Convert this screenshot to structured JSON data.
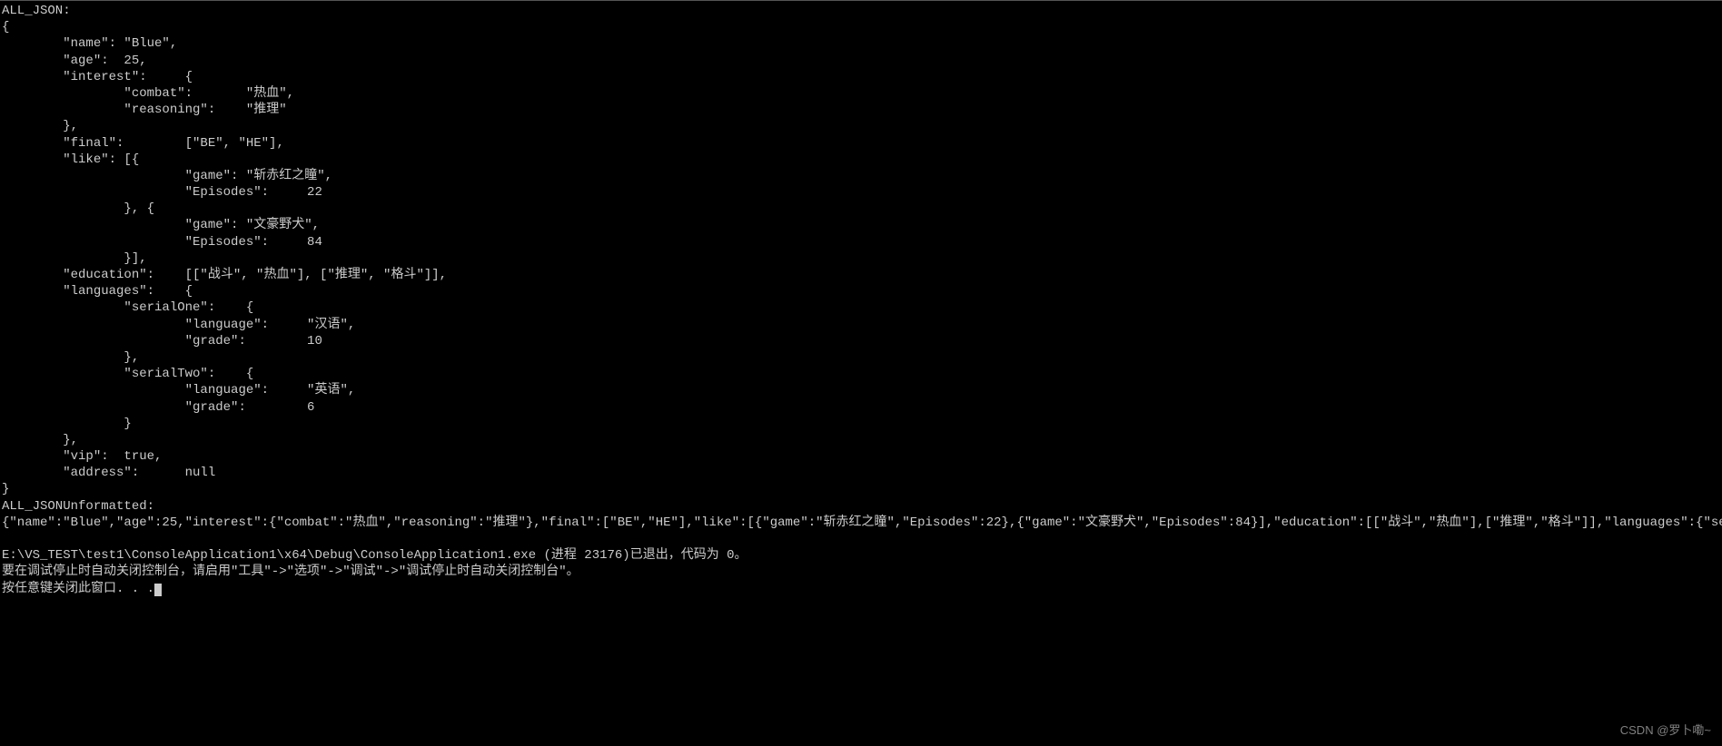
{
  "console": {
    "header1": "ALL_JSON:",
    "json_formatted": "{\n        \"name\": \"Blue\",\n        \"age\":  25,\n        \"interest\":     {\n                \"combat\":       \"热血\",\n                \"reasoning\":    \"推理\"\n        },\n        \"final\":        [\"BE\", \"HE\"],\n        \"like\": [{\n                        \"game\": \"斩赤红之瞳\",\n                        \"Episodes\":     22\n                }, {\n                        \"game\": \"文豪野犬\",\n                        \"Episodes\":     84\n                }],\n        \"education\":    [[\"战斗\", \"热血\"], [\"推理\", \"格斗\"]],\n        \"languages\":    {\n                \"serialOne\":    {\n                        \"language\":     \"汉语\",\n                        \"grade\":        10\n                },\n                \"serialTwo\":    {\n                        \"language\":     \"英语\",\n                        \"grade\":        6\n                }\n        },\n        \"vip\":  true,\n        \"address\":      null\n}",
    "header2": "ALL_JSONUnformatted:",
    "json_unformatted": "{\"name\":\"Blue\",\"age\":25,\"interest\":{\"combat\":\"热血\",\"reasoning\":\"推理\"},\"final\":[\"BE\",\"HE\"],\"like\":[{\"game\":\"斩赤红之瞳\",\"Episodes\":22},{\"game\":\"文豪野犬\",\"Episodes\":84}],\"education\":[[\"战斗\",\"热血\"],[\"推理\",\"格斗\"]],\"languages\":{\"serialOne\":{\"language\":\"汉语\",\"grade\":10},\"serialTwo\":{\"language\":\"英语\",\"grade\":6}},\"vip\":true,\"address\":null}",
    "blank": "",
    "exit_line": "E:\\VS_TEST\\test1\\ConsoleApplication1\\x64\\Debug\\ConsoleApplication1.exe (进程 23176)已退出，代码为 0。",
    "debug_hint": "要在调试停止时自动关闭控制台，请启用\"工具\"->\"选项\"->\"调试\"->\"调试停止时自动关闭控制台\"。",
    "press_key": "按任意键关闭此窗口. . ."
  },
  "watermark": "CSDN @罗卜嘞~"
}
